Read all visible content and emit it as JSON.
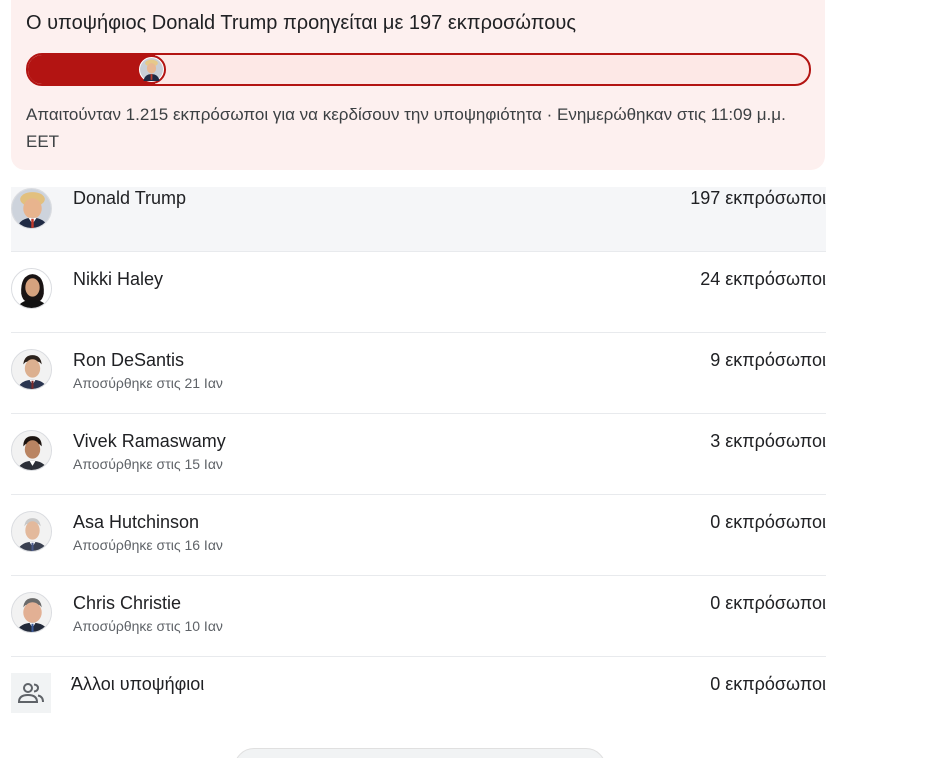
{
  "summary": {
    "headline": "Ο υποψήφιος Donald Trump προηγείται με 197 εκπροσώπους",
    "progress_fraction": 0.162,
    "leader_delegates": 197,
    "required_delegates": 1215,
    "subtitle": "Απαιτούνταν 1.215 εκπρόσωποι για να κερδίσουν την υποψηφιότητα · Ενημερώθηκαν στις 11:09 μ.μ. EET",
    "accent_color": "#b31412",
    "card_background": "#fdf0ef"
  },
  "candidates": [
    {
      "name": "Donald Trump",
      "status": "",
      "delegates": "197 εκπρόσωποι",
      "avatar": "trump-avatar"
    },
    {
      "name": "Nikki Haley",
      "status": "",
      "delegates": "24 εκπρόσωποι",
      "avatar": "haley-avatar"
    },
    {
      "name": "Ron DeSantis",
      "status": "Αποσύρθηκε στις 21 Ιαν",
      "delegates": "9 εκπρόσωποι",
      "avatar": "desantis-avatar"
    },
    {
      "name": "Vivek Ramaswamy",
      "status": "Αποσύρθηκε στις 15 Ιαν",
      "delegates": "3 εκπρόσωποι",
      "avatar": "ramaswamy-avatar"
    },
    {
      "name": "Asa Hutchinson",
      "status": "Αποσύρθηκε στις 16 Ιαν",
      "delegates": "0 εκπρόσωποι",
      "avatar": "hutchinson-avatar"
    },
    {
      "name": "Chris Christie",
      "status": "Αποσύρθηκε στις 10 Ιαν",
      "delegates": "0 εκπρόσωποι",
      "avatar": "christie-avatar"
    },
    {
      "name": "Άλλοι υποψήφιοι",
      "status": "",
      "delegates": "0 εκπρόσωποι",
      "avatar": "people-group-icon"
    }
  ]
}
